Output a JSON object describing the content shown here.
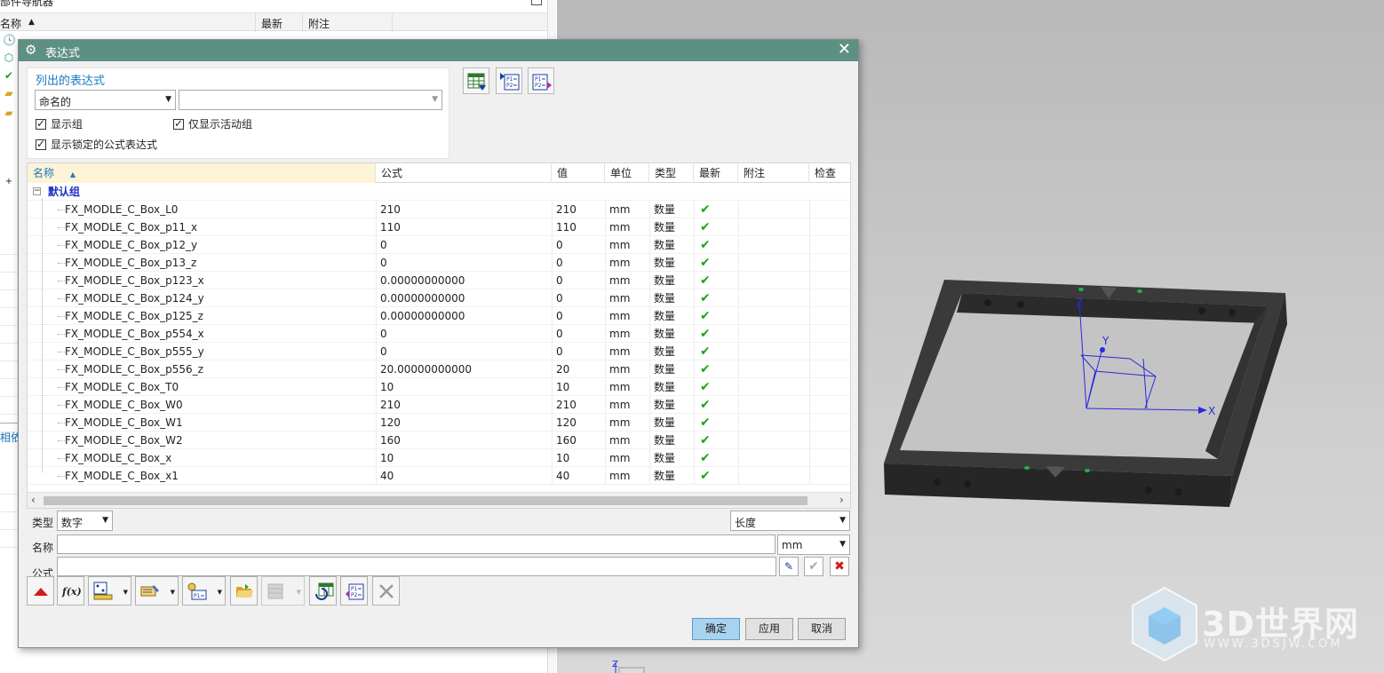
{
  "navigator": {
    "title": "部件导航器",
    "col_name": "名称",
    "col_latest": "最新",
    "col_comment": "附注",
    "dependents_label": "相依"
  },
  "dialog": {
    "title": "表达式",
    "listed_group_title": "列出的表达式",
    "filter_value": "命名的",
    "search_value": "",
    "chk_show_groups": "显示组",
    "chk_active_only": "仅显示活动组",
    "chk_show_locked": "显示锁定的公式表达式",
    "columns": [
      "名称",
      "公式",
      "值",
      "单位",
      "类型",
      "最新",
      "附注",
      "检查"
    ],
    "group_name": "默认组",
    "rows": [
      {
        "name": "FX_MODLE_C_Box_L0",
        "formula": "210",
        "value": "210",
        "unit": "mm",
        "type": "数量",
        "latest": "✔"
      },
      {
        "name": "FX_MODLE_C_Box_p11_x",
        "formula": "110",
        "value": "110",
        "unit": "mm",
        "type": "数量",
        "latest": "✔"
      },
      {
        "name": "FX_MODLE_C_Box_p12_y",
        "formula": "0",
        "value": "0",
        "unit": "mm",
        "type": "数量",
        "latest": "✔"
      },
      {
        "name": "FX_MODLE_C_Box_p13_z",
        "formula": "0",
        "value": "0",
        "unit": "mm",
        "type": "数量",
        "latest": "✔"
      },
      {
        "name": "FX_MODLE_C_Box_p123_x",
        "formula": "0.00000000000",
        "value": "0",
        "unit": "mm",
        "type": "数量",
        "latest": "✔"
      },
      {
        "name": "FX_MODLE_C_Box_p124_y",
        "formula": "0.00000000000",
        "value": "0",
        "unit": "mm",
        "type": "数量",
        "latest": "✔"
      },
      {
        "name": "FX_MODLE_C_Box_p125_z",
        "formula": "0.00000000000",
        "value": "0",
        "unit": "mm",
        "type": "数量",
        "latest": "✔"
      },
      {
        "name": "FX_MODLE_C_Box_p554_x",
        "formula": "0",
        "value": "0",
        "unit": "mm",
        "type": "数量",
        "latest": "✔"
      },
      {
        "name": "FX_MODLE_C_Box_p555_y",
        "formula": "0",
        "value": "0",
        "unit": "mm",
        "type": "数量",
        "latest": "✔"
      },
      {
        "name": "FX_MODLE_C_Box_p556_z",
        "formula": "20.00000000000",
        "value": "20",
        "unit": "mm",
        "type": "数量",
        "latest": "✔"
      },
      {
        "name": "FX_MODLE_C_Box_T0",
        "formula": "10",
        "value": "10",
        "unit": "mm",
        "type": "数量",
        "latest": "✔"
      },
      {
        "name": "FX_MODLE_C_Box_W0",
        "formula": "210",
        "value": "210",
        "unit": "mm",
        "type": "数量",
        "latest": "✔"
      },
      {
        "name": "FX_MODLE_C_Box_W1",
        "formula": "120",
        "value": "120",
        "unit": "mm",
        "type": "数量",
        "latest": "✔"
      },
      {
        "name": "FX_MODLE_C_Box_W2",
        "formula": "160",
        "value": "160",
        "unit": "mm",
        "type": "数量",
        "latest": "✔"
      },
      {
        "name": "FX_MODLE_C_Box_x",
        "formula": "10",
        "value": "10",
        "unit": "mm",
        "type": "数量",
        "latest": "✔"
      },
      {
        "name": "FX_MODLE_C_Box_x1",
        "formula": "40",
        "value": "40",
        "unit": "mm",
        "type": "数量",
        "latest": "✔"
      }
    ],
    "type_label": "类型",
    "type_value": "数字",
    "dimension_value": "长度",
    "name_label": "名称",
    "name_value": "",
    "unit_value": "mm",
    "formula_label": "公式",
    "formula_value": "",
    "btn_ok": "确定",
    "btn_apply": "应用",
    "btn_cancel": "取消"
  },
  "viewport": {
    "watermark_text": "3D世界网",
    "watermark_url": "WWW.3DSJW.COM",
    "axis_x": "X",
    "axis_y": "Y",
    "axis_z": "Z"
  },
  "colors": {
    "titlebar": "#5e8f83",
    "accent_blue": "#1a7abf",
    "group_blue": "#1d2fc4",
    "check_green": "#1fa31f",
    "ok_button": "#a9d2ee"
  }
}
